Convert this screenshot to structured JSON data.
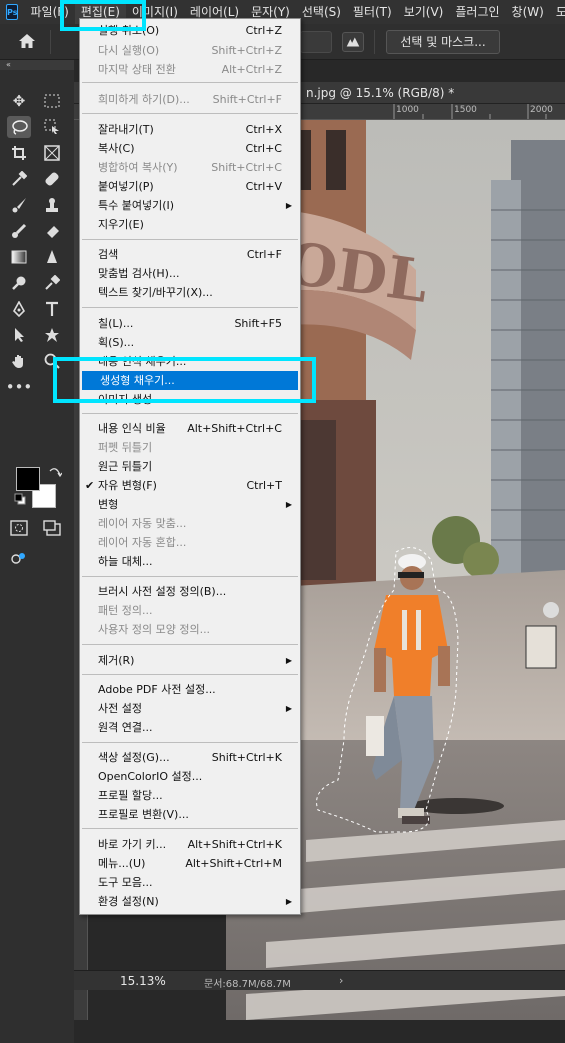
{
  "app": {
    "logo": "Ps",
    "accent": "#31a8ff"
  },
  "menubar": {
    "items": [
      "파일(F)",
      "편집(E)",
      "이미지(I)",
      "레이어(L)",
      "문자(Y)",
      "선택(S)",
      "필터(T)",
      "보기(V)",
      "플러그인",
      "창(W)",
      "도"
    ]
  },
  "optionsbar": {
    "select_mask_label": "선택 및 마스크..."
  },
  "toolbar": {
    "collapse": "«",
    "tools": [
      "move-tool",
      "marquee-tool",
      "lasso-tool",
      "object-select-tool",
      "crop-tool",
      "frame-tool",
      "eyedropper-tool",
      "healing-brush-tool",
      "brush-tool",
      "clone-stamp-tool",
      "history-brush-tool",
      "eraser-tool",
      "gradient-tool",
      "blur-tool",
      "dodge-tool",
      "pen-tool",
      "type-tool",
      "path-select-tool",
      "custom-shape-tool",
      "hand-tool",
      "zoom-tool",
      "more-tools"
    ],
    "foreground_color": "#000000",
    "background_color": "#ffffff"
  },
  "document": {
    "tab_title": "n.jpg @ 15.1% (RGB/8) *",
    "ruler_labels": [
      "1000",
      "1500",
      "2000"
    ],
    "zoom": "15.13%",
    "doc_size": "문서:68.7M/68.7M",
    "status_arrow": "›"
  },
  "edit_menu": {
    "highlight_color": "#0078d7",
    "items": [
      {
        "label": "실행 취소(O)",
        "shortcut": "Ctrl+Z",
        "disabled": false
      },
      {
        "label": "다시 실행(O)",
        "shortcut": "Shift+Ctrl+Z",
        "disabled": true
      },
      {
        "label": "마지막 상태 전환",
        "shortcut": "Alt+Ctrl+Z",
        "disabled": true
      },
      {
        "label": "희미하게 하기(D)...",
        "shortcut": "Shift+Ctrl+F",
        "disabled": true
      },
      {
        "label": "잘라내기(T)",
        "shortcut": "Ctrl+X",
        "disabled": false
      },
      {
        "label": "복사(C)",
        "shortcut": "Ctrl+C",
        "disabled": false
      },
      {
        "label": "병합하여 복사(Y)",
        "shortcut": "Shift+Ctrl+C",
        "disabled": true
      },
      {
        "label": "붙여넣기(P)",
        "shortcut": "Ctrl+V",
        "disabled": false
      },
      {
        "label": "특수 붙여넣기(I)",
        "shortcut": "",
        "disabled": false,
        "submenu": true
      },
      {
        "label": "지우기(E)",
        "shortcut": "",
        "disabled": false
      },
      {
        "label": "검색",
        "shortcut": "Ctrl+F",
        "disabled": false
      },
      {
        "label": "맞춤법 검사(H)...",
        "shortcut": "",
        "disabled": false
      },
      {
        "label": "텍스트 찾기/바꾸기(X)...",
        "shortcut": "",
        "disabled": false
      },
      {
        "label": "칠(L)...",
        "shortcut": "Shift+F5",
        "disabled": false
      },
      {
        "label": "획(S)...",
        "shortcut": "",
        "disabled": false
      },
      {
        "label": "내용 인식 채우기...",
        "shortcut": "",
        "disabled": false
      },
      {
        "label": "생성형 채우기...",
        "shortcut": "",
        "disabled": false,
        "highlighted": true
      },
      {
        "label": "이미지 생성...",
        "shortcut": "",
        "disabled": false
      },
      {
        "label": "내용 인식 비율",
        "shortcut": "Alt+Shift+Ctrl+C",
        "disabled": false
      },
      {
        "label": "퍼펫 뒤틀기",
        "shortcut": "",
        "disabled": true
      },
      {
        "label": "원근 뒤틀기",
        "shortcut": "",
        "disabled": false
      },
      {
        "label": "자유 변형(F)",
        "shortcut": "Ctrl+T",
        "disabled": false,
        "checked": true
      },
      {
        "label": "변형",
        "shortcut": "",
        "disabled": false,
        "submenu": true
      },
      {
        "label": "레이어 자동 맞춤...",
        "shortcut": "",
        "disabled": true
      },
      {
        "label": "레이어 자동 혼합...",
        "shortcut": "",
        "disabled": true
      },
      {
        "label": "하늘 대체...",
        "shortcut": "",
        "disabled": false
      },
      {
        "label": "브러시 사전 설정 정의(B)...",
        "shortcut": "",
        "disabled": false
      },
      {
        "label": "패턴 정의...",
        "shortcut": "",
        "disabled": true
      },
      {
        "label": "사용자 정의 모양 정의...",
        "shortcut": "",
        "disabled": true
      },
      {
        "label": "제거(R)",
        "shortcut": "",
        "disabled": false,
        "submenu": true
      },
      {
        "label": "Adobe PDF 사전 설정...",
        "shortcut": "",
        "disabled": false
      },
      {
        "label": "사전 설정",
        "shortcut": "",
        "disabled": false,
        "submenu": true
      },
      {
        "label": "원격 연결...",
        "shortcut": "",
        "disabled": false
      },
      {
        "label": "색상 설정(G)...",
        "shortcut": "Shift+Ctrl+K",
        "disabled": false
      },
      {
        "label": "OpenColorIO 설정...",
        "shortcut": "",
        "disabled": false
      },
      {
        "label": "프로필 할당...",
        "shortcut": "",
        "disabled": false
      },
      {
        "label": "프로필로 변환(V)...",
        "shortcut": "",
        "disabled": false
      },
      {
        "label": "바로 가기 키...",
        "shortcut": "Alt+Shift+Ctrl+K",
        "disabled": false
      },
      {
        "label": "메뉴...(U)",
        "shortcut": "Alt+Shift+Ctrl+M",
        "disabled": false
      },
      {
        "label": "도구 모음...",
        "shortcut": "",
        "disabled": false
      },
      {
        "label": "환경 설정(N)",
        "shortcut": "",
        "disabled": false,
        "submenu": true
      }
    ]
  },
  "photo": {
    "sign_text": "OODL"
  }
}
